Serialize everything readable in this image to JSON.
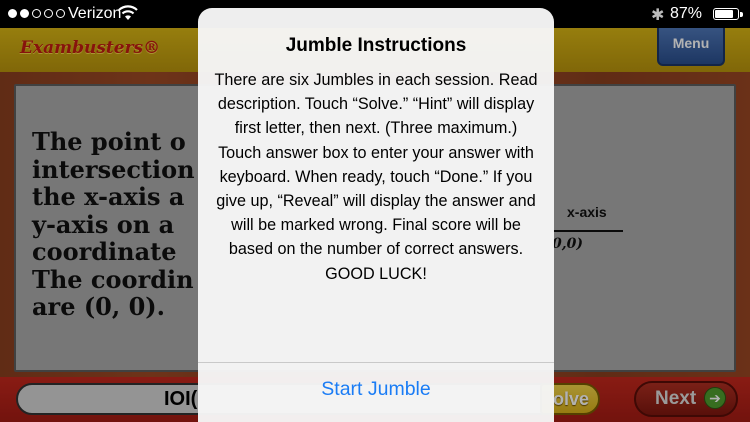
{
  "status_bar": {
    "carrier": "Verizon",
    "battery_percent": "87%",
    "signal_bars_filled": 2,
    "signal_bars_total": 5,
    "battery_fill": 0.87
  },
  "header": {
    "logo": "Exambusters®",
    "menu_label": "Menu"
  },
  "card": {
    "question_lines": [
      "The point o",
      "intersection",
      "the x-axis a",
      "y-axis on a",
      "coordinate",
      "The coordin",
      "are (0, 0)."
    ],
    "axis_label": "x-axis",
    "origin_label": "0,0)"
  },
  "bottom_bar": {
    "answer_text": "IOI(",
    "solve_label": "olve",
    "next_label": "Next"
  },
  "alert": {
    "title": "Jumble Instructions",
    "body": "There are six Jumbles in each session. Read description. Touch “Solve.” “Hint” will display first letter, then next. (Three maximum.) Touch answer box to enter your answer with keyboard. When ready, touch “Done.” If you give up, “Reveal” will display the answer and will be marked wrong. Final score will be based on the number of correct answers. GOOD LUCK!",
    "action_label": "Start Jumble"
  },
  "colors": {
    "header_gold": "#c9a411",
    "logo_red": "#c21c12",
    "menu_blue": "#3a62a6",
    "wood_brown": "#9a4723",
    "card_gray": "#ababab",
    "bottom_red": "#b3221a",
    "link_blue": "#1a7cf5"
  }
}
